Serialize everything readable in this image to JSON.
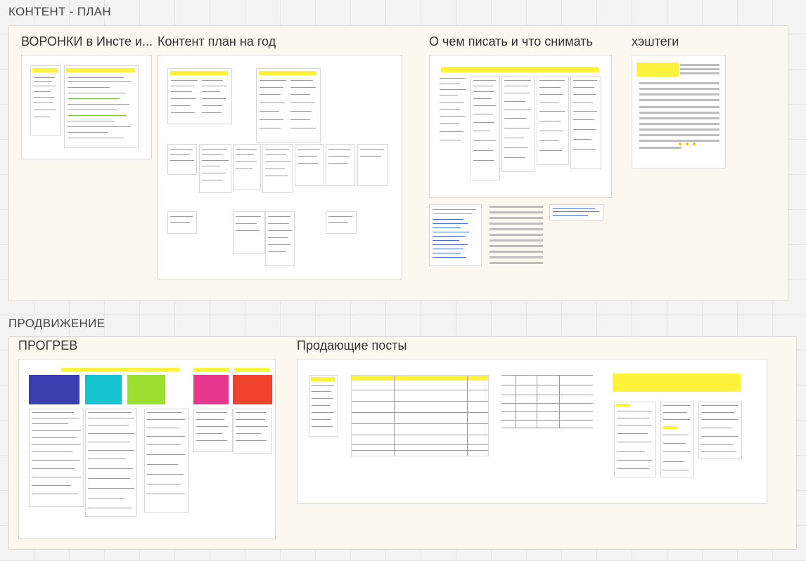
{
  "board": {
    "sections": {
      "content_plan": "КОНТЕНТ -  ПЛАН",
      "promotion": "ПРОДВИЖЕНИЕ"
    },
    "frames": {
      "funnels": "ВОРОНКИ в Инсте и...",
      "year_plan": "Контент план на год",
      "what_to_write": "О чем писать и что снимать",
      "hashtags": "хэштеги",
      "warmup": "ПРОГРЕВ",
      "selling_posts": "Продающие посты"
    }
  },
  "colors": {
    "board_bg": "#f3f3f3",
    "panel_bg": "#fbf9ef",
    "sticky_yellow": "#fff23a",
    "block_blue": "#3a3fb0",
    "block_teal": "#17c3cf",
    "block_green": "#9be02f",
    "block_magenta": "#e8388e",
    "block_red": "#f0442e"
  }
}
